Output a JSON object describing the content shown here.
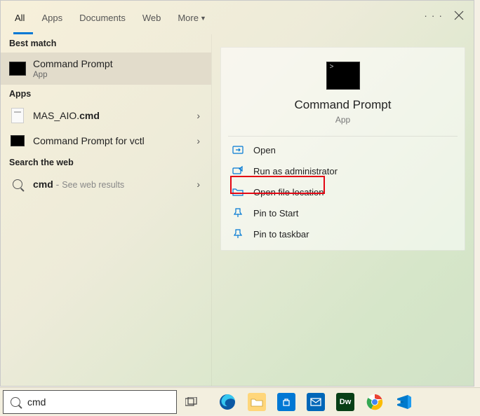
{
  "tabs": {
    "items": [
      "All",
      "Apps",
      "Documents",
      "Web",
      "More"
    ],
    "active_index": 0
  },
  "sections": {
    "best_match": "Best match",
    "apps": "Apps",
    "search_web": "Search the web"
  },
  "best_result": {
    "title": "Command Prompt",
    "subtitle": "App"
  },
  "app_results": [
    {
      "title_prefix": "MAS_AIO.",
      "title_bold": "cmd"
    },
    {
      "title": "Command Prompt for vctl"
    }
  ],
  "web_result": {
    "bold": "cmd",
    "separator": " - ",
    "hint": "See web results"
  },
  "preview": {
    "title": "Command Prompt",
    "subtitle": "App",
    "actions": {
      "open": "Open",
      "run_admin": "Run as administrator",
      "open_loc": "Open file location",
      "pin_start": "Pin to Start",
      "pin_taskbar": "Pin to taskbar"
    }
  },
  "taskbar": {
    "search_value": "cmd",
    "apps": [
      {
        "name": "edge",
        "bg": "transparent"
      },
      {
        "name": "file-explorer",
        "bg": "#ffd67a"
      },
      {
        "name": "ms-store",
        "bg": "#0078d4"
      },
      {
        "name": "mail",
        "bg": "#0067b8"
      },
      {
        "name": "dreamweaver",
        "bg": "#36402a",
        "letter": "Dw"
      },
      {
        "name": "chrome",
        "bg": "transparent"
      },
      {
        "name": "vscode",
        "bg": "#0065a9"
      }
    ]
  }
}
